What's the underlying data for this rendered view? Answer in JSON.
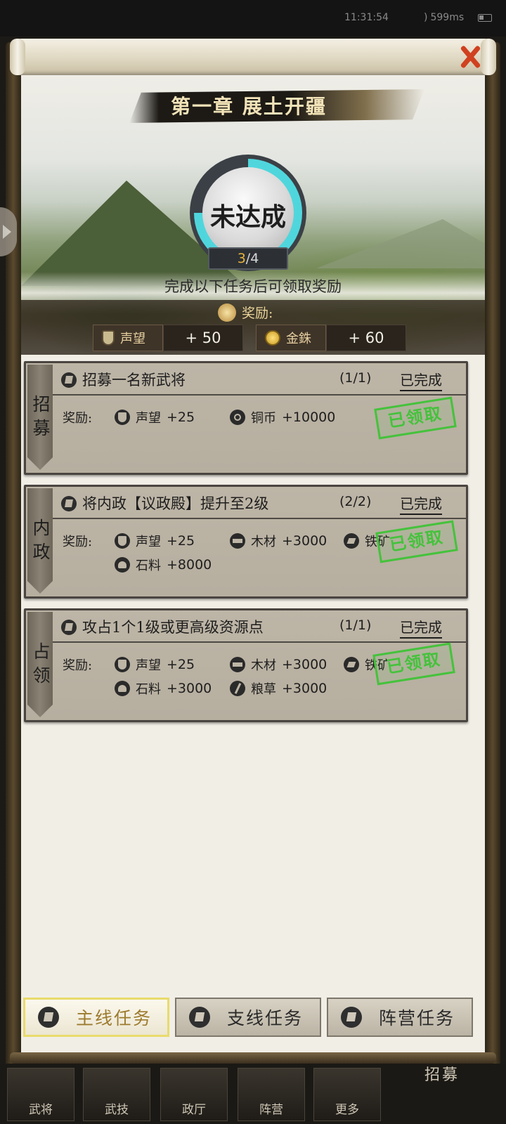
{
  "status_bar": {
    "time": "11:31:54",
    "network": "599ms"
  },
  "chapter": {
    "title": "第一章 展土开疆",
    "state_label": "未达成",
    "progress_current": "3",
    "progress_sep": "/",
    "progress_total": "4",
    "progress_fraction": 0.75,
    "hint": "完成以下任务后可领取奖励",
    "reward_header": "奖励:",
    "rewards": [
      {
        "name": "声望",
        "value": "+ 50",
        "icon": "shield-icon"
      },
      {
        "name": "金銖",
        "value": "+ 60",
        "icon": "gold-coin-icon"
      }
    ]
  },
  "reward_label": "奖励:",
  "tasks": [
    {
      "tab": [
        "招",
        "募"
      ],
      "title": "招募一名新武将",
      "count": "(1/1)",
      "status": "已完成",
      "stamp": "已领取",
      "rewards": [
        {
          "icon": "shield",
          "name": "声望",
          "value": "+25"
        },
        {
          "icon": "coin",
          "name": "铜币",
          "value": "+10000"
        }
      ]
    },
    {
      "tab": [
        "内",
        "政"
      ],
      "title": "将内政【议政殿】提升至2级",
      "count": "(2/2)",
      "status": "已完成",
      "stamp": "已领取",
      "rewards": [
        {
          "icon": "shield",
          "name": "声望",
          "value": "+25"
        },
        {
          "icon": "wood",
          "name": "木材",
          "value": "+3000"
        },
        {
          "icon": "iron",
          "name": "铁矿",
          "value": ""
        },
        {
          "icon": "stone",
          "name": "石料",
          "value": "+8000"
        }
      ]
    },
    {
      "tab": [
        "占",
        "领"
      ],
      "title": "攻占1个1级或更高级资源点",
      "count": "(1/1)",
      "status": "已完成",
      "stamp": "已领取",
      "rewards": [
        {
          "icon": "shield",
          "name": "声望",
          "value": "+25"
        },
        {
          "icon": "wood",
          "name": "木材",
          "value": "+3000"
        },
        {
          "icon": "iron",
          "name": "铁矿",
          "value": ""
        },
        {
          "icon": "stone",
          "name": "石料",
          "value": "+3000"
        },
        {
          "icon": "grain",
          "name": "粮草",
          "value": "+3000"
        }
      ]
    }
  ],
  "tabs": [
    {
      "label": "主线任务",
      "active": true
    },
    {
      "label": "支线任务",
      "active": false
    },
    {
      "label": "阵营任务",
      "active": false
    }
  ],
  "game_nav": [
    "武将",
    "武技",
    "政厅",
    "阵营",
    "更多",
    "招募"
  ]
}
